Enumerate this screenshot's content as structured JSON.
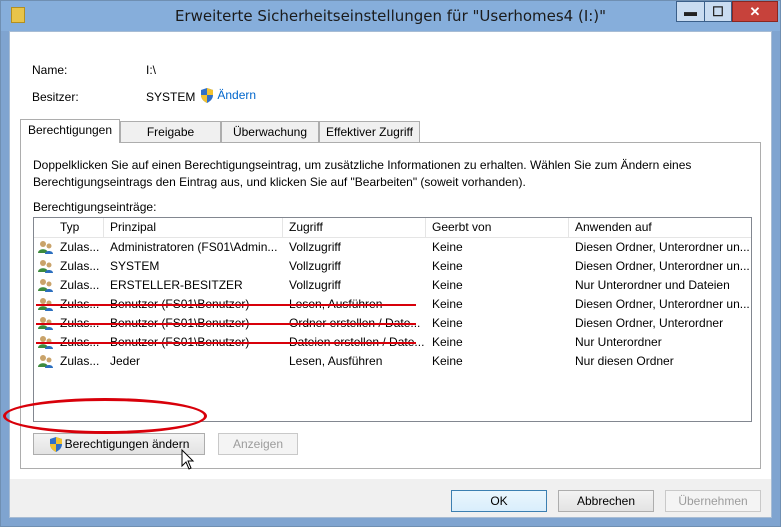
{
  "window": {
    "title": "Erweiterte Sicherheitseinstellungen für \"Userhomes4 (I:)\"",
    "min_glyph": "▬",
    "max_glyph": "☐",
    "close_glyph": "✕"
  },
  "header": {
    "name_label": "Name:",
    "name_value": "I:\\",
    "owner_label": "Besitzer:",
    "owner_value": "SYSTEM",
    "change_link": "Ändern"
  },
  "tabs": [
    {
      "label": "Berechtigungen",
      "active": true
    },
    {
      "label": "Freigabe",
      "active": false
    },
    {
      "label": "Überwachung",
      "active": false
    },
    {
      "label": "Effektiver Zugriff",
      "active": false
    }
  ],
  "permissions": {
    "description": "Doppelklicken Sie auf einen Berechtigungseintrag, um zusätzliche Informationen zu erhalten. Wählen Sie zum Ändern eines Berechtigungseintrags den Eintrag aus, und klicken Sie auf \"Bearbeiten\" (soweit vorhanden).",
    "entries_label": "Berechtigungseinträge:",
    "columns": [
      "Typ",
      "Prinzipal",
      "Zugriff",
      "Geerbt von",
      "Anwenden auf"
    ],
    "rows": [
      {
        "type": "Zulas...",
        "principal": "Administratoren (FS01\\Admin...",
        "access": "Vollzugriff",
        "inherited": "Keine",
        "applies": "Diesen Ordner, Unterordner un...",
        "struck": false
      },
      {
        "type": "Zulas...",
        "principal": "SYSTEM",
        "access": "Vollzugriff",
        "inherited": "Keine",
        "applies": "Diesen Ordner, Unterordner un...",
        "struck": false
      },
      {
        "type": "Zulas...",
        "principal": "ERSTELLER-BESITZER",
        "access": "Vollzugriff",
        "inherited": "Keine",
        "applies": "Nur Unterordner und Dateien",
        "struck": false
      },
      {
        "type": "Zulas...",
        "principal": "Benutzer (FS01\\Benutzer)",
        "access": "Lesen, Ausführen",
        "inherited": "Keine",
        "applies": "Diesen Ordner, Unterordner un...",
        "struck": true
      },
      {
        "type": "Zulas...",
        "principal": "Benutzer (FS01\\Benutzer)",
        "access": "Ordner erstellen / Date...",
        "inherited": "Keine",
        "applies": "Diesen Ordner, Unterordner",
        "struck": true
      },
      {
        "type": "Zulas...",
        "principal": "Benutzer (FS01\\Benutzer)",
        "access": "Dateien erstellen / Date...",
        "inherited": "Keine",
        "applies": "Nur Unterordner",
        "struck": true
      },
      {
        "type": "Zulas...",
        "principal": "Jeder",
        "access": "Lesen, Ausführen",
        "inherited": "Keine",
        "applies": "Nur diesen Ordner",
        "struck": false
      }
    ],
    "change_permissions_button": "Berechtigungen ändern",
    "view_button": "Anzeigen"
  },
  "footer": {
    "ok": "OK",
    "cancel": "Abbrechen",
    "apply": "Übernehmen"
  },
  "colors": {
    "strike": "#d8000a",
    "highlight_ellipse": "#d8000a",
    "link": "#0066cc"
  }
}
